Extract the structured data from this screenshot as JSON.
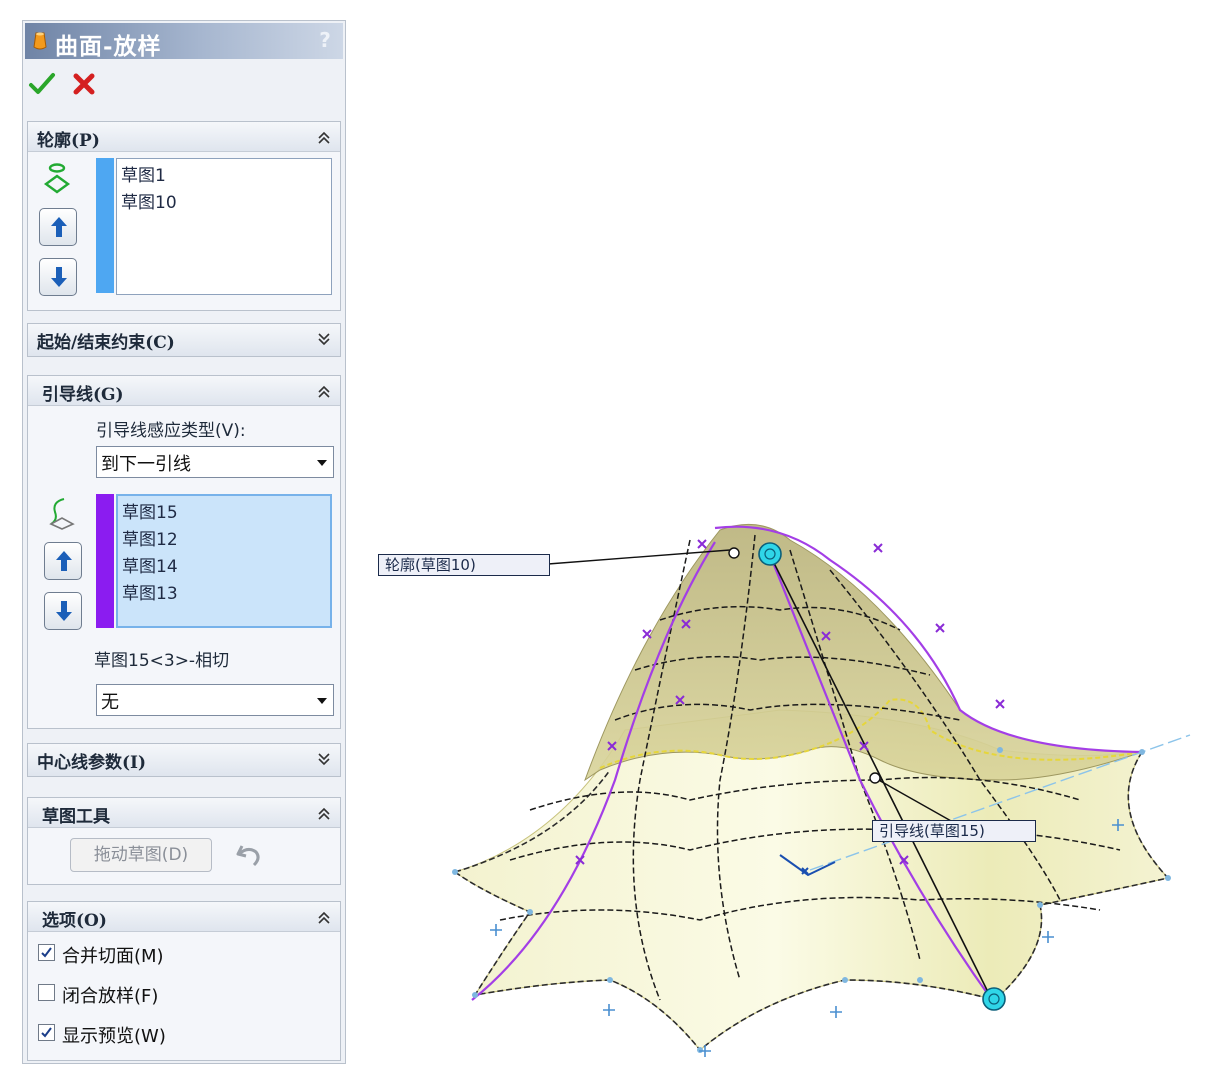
{
  "title": "曲面-放样",
  "help": "?",
  "profiles": {
    "header": "轮廓(P)",
    "items": [
      "草图1",
      "草图10"
    ],
    "colorbar": "#4ea7f2"
  },
  "start_end": {
    "header": "起始/结束约束(C)"
  },
  "guides": {
    "header": "引导线(G)",
    "influence_label": "引导线感应类型(V):",
    "influence_value": "到下一引线",
    "items": [
      "草图15",
      "草图12",
      "草图14",
      "草图13"
    ],
    "colorbar": "#8b1cf0",
    "tangency_label": "草图15<3>-相切",
    "tangency_value": "无"
  },
  "centerline": {
    "header": "中心线参数(I)"
  },
  "sketch_tools": {
    "header": "草图工具",
    "drag_button": "拖动草图(D)"
  },
  "options": {
    "header": "选项(O)",
    "merge_faces": {
      "label": "合并切面(M)",
      "checked": true
    },
    "close_loft": {
      "label": "闭合放样(F)",
      "checked": false
    },
    "show_preview": {
      "label": "显示预览(W)",
      "checked": true
    }
  },
  "viewport": {
    "callout_profile": "轮廓(草图10)",
    "callout_guide": "引导线(草图15)",
    "surface_color": "#efeec0",
    "guide_color": "#a33ee6",
    "handle_color": "#2fd6e8"
  }
}
